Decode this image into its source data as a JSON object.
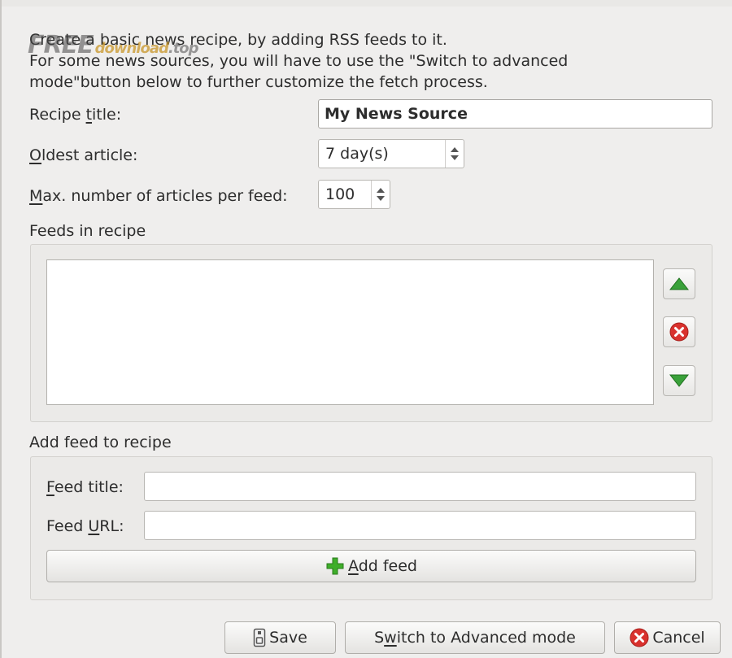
{
  "intro": {
    "line1": "Create a basic news recipe, by adding RSS feeds to it.",
    "line2": "For some news sources, you will have to use the \"Switch to advanced",
    "line3": "mode\"button below to further customize the fetch process."
  },
  "watermark": {
    "part1": "FREE",
    "part2": "download",
    "part3": ".top"
  },
  "recipe_title": {
    "label_pre": "Recipe ",
    "label_key": "t",
    "label_post": "itle:",
    "value": "My News Source"
  },
  "oldest_article": {
    "label_key": "O",
    "label_post": "ldest article:",
    "value": "7 day(s)"
  },
  "max_articles": {
    "label_key": "M",
    "label_post": "ax. number of articles per feed:",
    "value": "100"
  },
  "feeds_section": {
    "title": "Feeds in recipe",
    "feeds": []
  },
  "feed_buttons": {
    "up": "move-up",
    "remove": "remove",
    "down": "move-down"
  },
  "add_feed_section": {
    "title": "Add feed to recipe",
    "feed_title_label_key": "F",
    "feed_title_label_post": "eed title:",
    "feed_title_value": "",
    "feed_url_label_pre": "Feed ",
    "feed_url_label_key": "U",
    "feed_url_label_post": "RL:",
    "feed_url_value": "",
    "add_button_key": "A",
    "add_button_post": "dd feed"
  },
  "footer": {
    "save_label": "Save",
    "switch_pre": "S",
    "switch_key": "w",
    "switch_post": "itch to Advanced mode",
    "cancel_label": "Cancel"
  },
  "colors": {
    "green_arrow": "#3aa13a",
    "remove_red": "#d9322e",
    "plus_green": "#3fae2a"
  }
}
